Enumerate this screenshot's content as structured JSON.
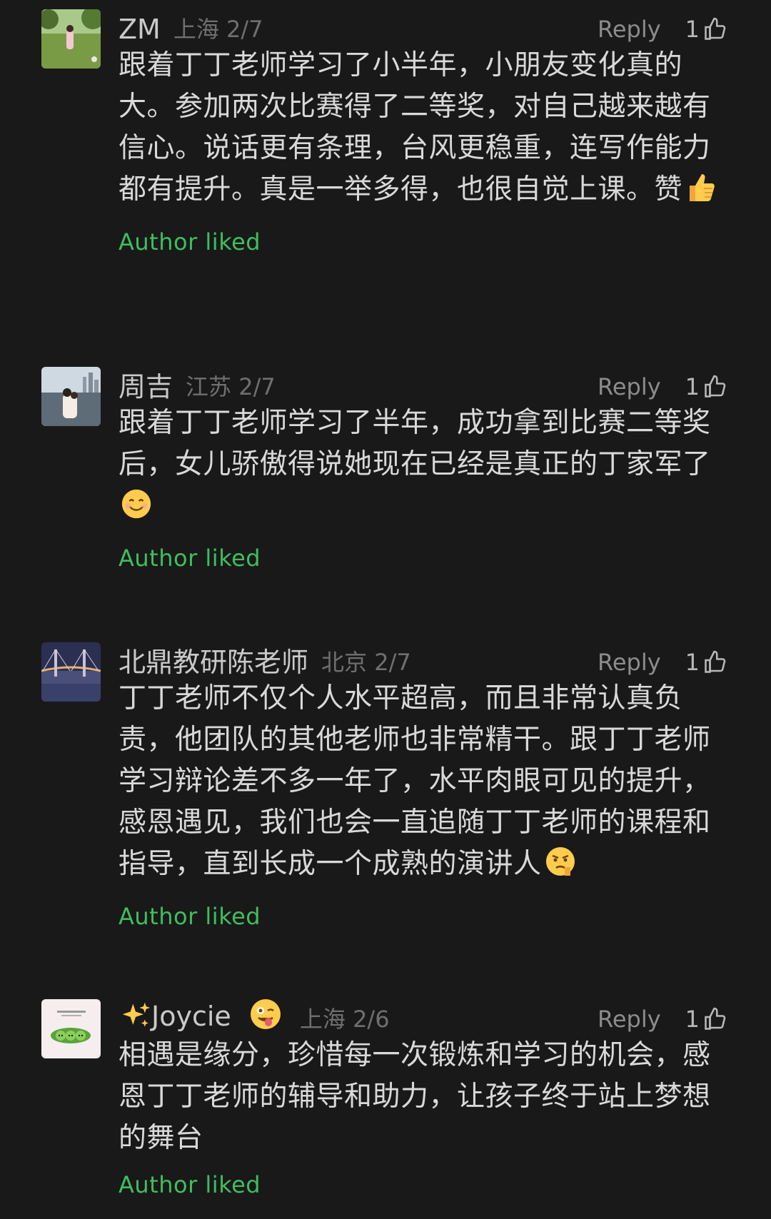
{
  "theme": {
    "accent": "#3fbe5e",
    "bg": "#191919"
  },
  "comments": [
    {
      "name": "ZM",
      "location": "上海",
      "date": "2/7",
      "reply_label": "Reply",
      "like_count": "1",
      "text": "跟着丁丁老师学习了小半年，小朋友变化真的大。参加两次比赛得了二等奖，对自己越来越有信心。说话更有条理，台风更稳重，连写作能力都有提升。真是一举多得，也很自觉上课。赞",
      "text_emoji": "thumbs-up",
      "author_liked": "Author liked",
      "avatar": "person-on-grass-photo"
    },
    {
      "name": "周吉",
      "location": "江苏",
      "date": "2/7",
      "reply_label": "Reply",
      "like_count": "1",
      "text": "跟着丁丁老师学习了半年，成功拿到比赛二等奖后，女儿骄傲得说她现在已经是真正的丁家军了",
      "text_emoji": "smiling-face",
      "author_liked": "Author liked",
      "avatar": "kids-by-river-photo"
    },
    {
      "name": "北鼎教研陈老师",
      "location": "北京",
      "date": "2/7",
      "reply_label": "Reply",
      "like_count": "1",
      "text": "丁丁老师不仅个人水平超高，而且非常认真负责，他团队的其他老师也非常精干。跟丁丁老师学习辩论差不多一年了，水平肉眼可见的提升，感恩遇见，我们也会一直追随丁丁老师的课程和指导，直到长成一个成熟的演讲人",
      "text_emoji": "determined-face",
      "author_liked": "Author liked",
      "avatar": "bridge-at-dusk-photo"
    },
    {
      "name": "Joycie",
      "name_prefix_emoji": "sparkles",
      "name_suffix_emoji": "winking-face-with-tongue",
      "location": "上海",
      "date": "2/6",
      "reply_label": "Reply",
      "like_count": "1",
      "text": "相遇是缘分，珍惜每一次锻炼和学习的机会，感恩丁丁老师的辅导和助力，让孩子终于站上梦想的舞台",
      "author_liked": "Author liked",
      "avatar": "pea-pod-illustration"
    }
  ]
}
